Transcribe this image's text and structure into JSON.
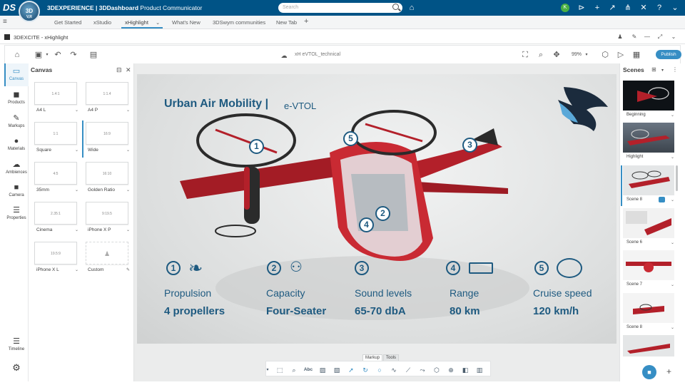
{
  "topbar": {
    "logo_text": "3D",
    "version": "V,R",
    "brand_bold": "3DEXPERIENCE | 3DDashboard",
    "brand_app": "Product Communicator",
    "search_placeholder": "Search"
  },
  "tabs": [
    "Get Started",
    "xStudio",
    "xHighlight",
    "What's New",
    "3DSwym communities",
    "New Tab"
  ],
  "active_tab": "xHighlight",
  "app": {
    "title": "3DEXCITE - xHighlight"
  },
  "toolbar": {
    "doc_name": "xH eVTOL_technical",
    "zoom": "99%",
    "publish_label": "Publish"
  },
  "leftnav": [
    {
      "label": "Canvas",
      "icon": "canvas-icon"
    },
    {
      "label": "Products",
      "icon": "cube-icon"
    },
    {
      "label": "Markups",
      "icon": "markup-icon"
    },
    {
      "label": "Materials",
      "icon": "sphere-icon"
    },
    {
      "label": "Ambiences",
      "icon": "ambience-icon"
    },
    {
      "label": "Camera",
      "icon": "camera-icon"
    },
    {
      "label": "Properties",
      "icon": "sliders-icon"
    }
  ],
  "timeline_label": "Timeline",
  "canvas_panel": {
    "title": "Canvas",
    "formats": [
      {
        "ratio": "1.4:1",
        "label": "A4 L"
      },
      {
        "ratio": "1:1.4",
        "label": "A4 P"
      },
      {
        "ratio": "1:1",
        "label": "Square"
      },
      {
        "ratio": "16:9",
        "label": "Wide"
      },
      {
        "ratio": "4:5",
        "label": "35mm"
      },
      {
        "ratio": "16:10",
        "label": "Golden Ratio"
      },
      {
        "ratio": "2.35:1",
        "label": "Cinema"
      },
      {
        "ratio": "9:19.5",
        "label": "iPhone X P"
      },
      {
        "ratio": "19.5:9",
        "label": "iPhone X L"
      },
      {
        "ratio": "",
        "label": "Custom"
      }
    ],
    "selected": "Wide"
  },
  "viewport": {
    "title": "Urban Air Mobility |",
    "subtitle": "e-VTOL",
    "callouts": [
      "1",
      "5",
      "3",
      "2",
      "4"
    ],
    "specs": [
      {
        "n": "1",
        "heading": "Propulsion",
        "value": "4 propellers"
      },
      {
        "n": "2",
        "heading": "Capacity",
        "value": "Four-Seater"
      },
      {
        "n": "3",
        "heading": "Sound levels",
        "value": "65-70 dbA"
      },
      {
        "n": "4",
        "heading": "Range",
        "value": "80 km"
      },
      {
        "n": "5",
        "heading": "Cruise speed",
        "value": "120 km/h"
      }
    ]
  },
  "scenes": {
    "title": "Scenes",
    "items": [
      "Beginning",
      "Highlight",
      "Scene 8",
      "Scene 6",
      "Scene 7",
      "Scene 8"
    ]
  },
  "markup_tabs": [
    "Markup",
    "Tools"
  ],
  "markup_tools": [
    "screenshot-icon",
    "zoom-tool-icon",
    "text-abc-icon",
    "image-icon",
    "crop-icon",
    "arrow-icon",
    "rotate-icon",
    "circle-icon",
    "freehand-icon",
    "line-icon",
    "curve-icon",
    "box-icon",
    "measure-icon",
    "section-icon",
    "grid-icon"
  ],
  "colors": {
    "brand": "#005386",
    "accent": "#368ec4",
    "title": "#1e5a80",
    "aircraft_red": "#b3202a"
  }
}
